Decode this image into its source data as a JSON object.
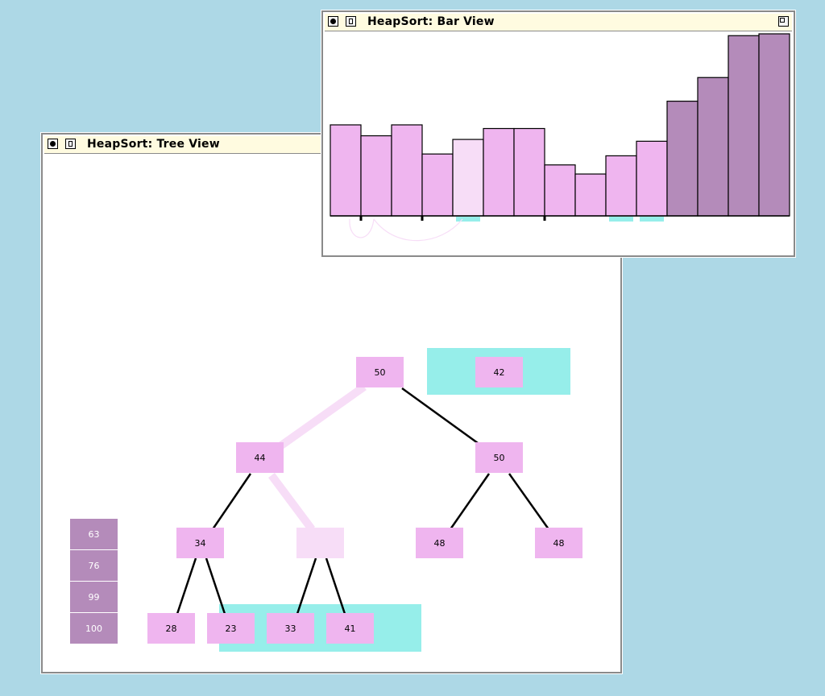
{
  "tree_window": {
    "title": "HeapSort: Tree View",
    "sorted_stack": [
      "63",
      "76",
      "99",
      "100"
    ],
    "nodes": {
      "root": "50",
      "left": "44",
      "right": "50",
      "ll": "34",
      "lr": "",
      "rl": "48",
      "rr": "48",
      "lll": "28",
      "llr": "23",
      "lrl": "33",
      "lrr": "41",
      "floating": "42"
    }
  },
  "bar_window": {
    "title": "HeapSort: Bar View"
  },
  "chart_data": {
    "type": "bar",
    "values": [
      50,
      44,
      50,
      34,
      42,
      48,
      48,
      28,
      23,
      33,
      41,
      63,
      76,
      99,
      100
    ],
    "states": [
      "heap",
      "heap",
      "heap",
      "heap",
      "active",
      "heap",
      "heap",
      "heap",
      "heap",
      "heap",
      "heap",
      "sorted",
      "sorted",
      "sorted",
      "sorted"
    ],
    "highlighted_indices": [
      4,
      9,
      10
    ],
    "colors": {
      "heap": "#efb5ef",
      "active": "#f7ddf7",
      "sorted": "#b48bba",
      "highlight": "#96eeea"
    }
  },
  "colors": {
    "desktop": "#add8e6",
    "node": "#efb5ef",
    "node_light": "#f7ddf7",
    "sorted": "#b48bba",
    "highlight": "#96eeea"
  }
}
